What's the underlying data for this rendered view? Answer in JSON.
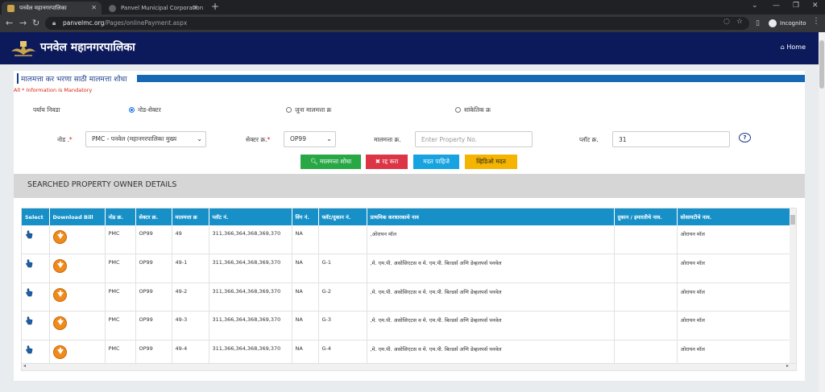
{
  "browser": {
    "tabs": [
      {
        "title": "पनवेल महानगरपालिका",
        "active": true
      },
      {
        "title": "Panvel Municipal Corporation O...",
        "active": false
      }
    ],
    "url_host": "panvelmc.org",
    "url_path": "/Pages/onlinePayment.aspx",
    "profile_label": "Incognito"
  },
  "site": {
    "title": "पनवेल महानगरपालिका",
    "home_label": "Home"
  },
  "form": {
    "section_title": "मालमत्ता कर भरणा साठी मालमत्ता शोधा",
    "mandatory_note": "All * Information is Mandatory",
    "option_label": "पर्याय निवडा",
    "options": [
      {
        "label": "नोड-सेक्टर",
        "checked": true
      },
      {
        "label": "जुना मालमत्ता क्र",
        "checked": false
      },
      {
        "label": "सांकेतिक क्र",
        "checked": false
      }
    ],
    "node_label": "नोड .",
    "node_value": "PMC - पनवेल (महानगरपालिका मुख्य",
    "sector_label": "सेक्टर क्र.",
    "sector_value": "OP99",
    "property_label": "मालमत्ता क्र.",
    "property_placeholder": "Enter Property No.",
    "plot_label": "प्लॉट क्र.",
    "plot_value": "31",
    "buttons": {
      "search": "मालमत्ता शोधा",
      "cancel": "रद्द करा",
      "help": "मदत पाहिजे",
      "video": "व्हिडिओ मदत"
    }
  },
  "owner_section_title": "SEARCHED PROPERTY OWNER DETAILS",
  "table": {
    "headers": [
      "Select",
      "Download Bill",
      "नोड क्र.",
      "सेक्टर क्र.",
      "मालमत्ता क्र",
      "प्लॉट नं.",
      "विंग नं.",
      "फ्लॅट/दुकान नं.",
      "प्राथमिक करधारकाचे नाव",
      "दुकान / इमारतीचे नाव.",
      "सोसायटीचे नाव."
    ],
    "rows": [
      [
        "",
        "",
        "PMC",
        "OP99",
        "49",
        "311,366,364,368,369,370",
        "NA",
        "",
        ",ओरायन मॉल",
        "",
        "ओरायन मॉल"
      ],
      [
        "",
        "",
        "PMC",
        "OP99",
        "49-1",
        "311,366,364,368,369,370",
        "NA",
        "G-1",
        ",मे. एम.पी. असोसिएटस व मे. एम.पी. बिल्डर्स अणि डेव्हलपर्स पनवेल",
        "",
        "ओरायन मॉल"
      ],
      [
        "",
        "",
        "PMC",
        "OP99",
        "49-2",
        "311,366,364,368,369,370",
        "NA",
        "G-2",
        ",मे. एम.पी. असोसिएटस व मे. एम.पी. बिल्डर्स अणि डेव्हलपर्स पनवेल",
        "",
        "ओरायन मॉल"
      ],
      [
        "",
        "",
        "PMC",
        "OP99",
        "49-3",
        "311,366,364,368,369,370",
        "NA",
        "G-3",
        ",मे. एम.पी. असोसिएटस व मे. एम.पी. बिल्डर्स अणि डेव्हलपर्स पनवेल",
        "",
        "ओरायन मॉल"
      ],
      [
        "",
        "",
        "PMC",
        "OP99",
        "49-4",
        "311,366,364,368,369,370",
        "NA",
        "G-4",
        ",मे. एम.पी. असोसिएटस व मे. एम.पी. बिल्डर्स अणि डेव्हलपर्स पनवेल",
        "",
        "ओरायन मॉल"
      ]
    ]
  },
  "colors": {
    "header_navy": "#0c1a5c",
    "section_blue": "#1668b5",
    "table_header": "#1790c8",
    "btn_search": "#28a745",
    "btn_cancel": "#dc3545",
    "btn_help": "#17a2e0",
    "btn_video": "#f5b400"
  }
}
